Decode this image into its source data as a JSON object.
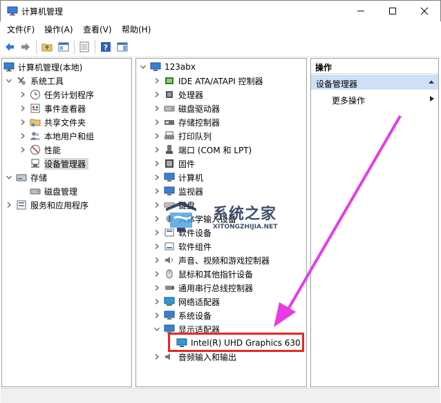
{
  "window": {
    "title": "计算机管理"
  },
  "menu": {
    "items": [
      "文件(F)",
      "操作(A)",
      "查看(V)",
      "帮助(H)"
    ]
  },
  "left_tree": {
    "root": "计算机管理(本地)",
    "system_tools": "系统工具",
    "task_scheduler": "任务计划程序",
    "event_viewer": "事件查看器",
    "shared_folders": "共享文件夹",
    "local_users": "本地用户和组",
    "performance": "性能",
    "device_manager": "设备管理器",
    "storage": "存储",
    "disk_management": "磁盘管理",
    "services_apps": "服务和应用程序"
  },
  "device_tree": {
    "computer_name": "123abx",
    "categories": [
      "IDE ATA/ATAPI 控制器",
      "处理器",
      "磁盘驱动器",
      "存储控制器",
      "打印队列",
      "端口 (COM 和 LPT)",
      "固件",
      "计算机",
      "监视器",
      "键盘",
      "人体学输入设备",
      "软件设备",
      "软件组件",
      "声音、视频和游戏控制器",
      "鼠标和其他指针设备",
      "通用串行总线控制器",
      "网络适配器",
      "系统设备",
      "显示适配器"
    ],
    "display_child": "Intel(R) UHD Graphics 630",
    "audio_io": "音频输入和输出"
  },
  "actions_pane": {
    "header": "操作",
    "section": "设备管理器",
    "more": "更多操作"
  },
  "watermark": {
    "title": "系统之家",
    "subtitle": "XITONGZHIJIA.NET"
  },
  "colors": {
    "selection": "#cde0f6",
    "highlight_box": "#e8261f",
    "arrow": "#e83ae8"
  }
}
